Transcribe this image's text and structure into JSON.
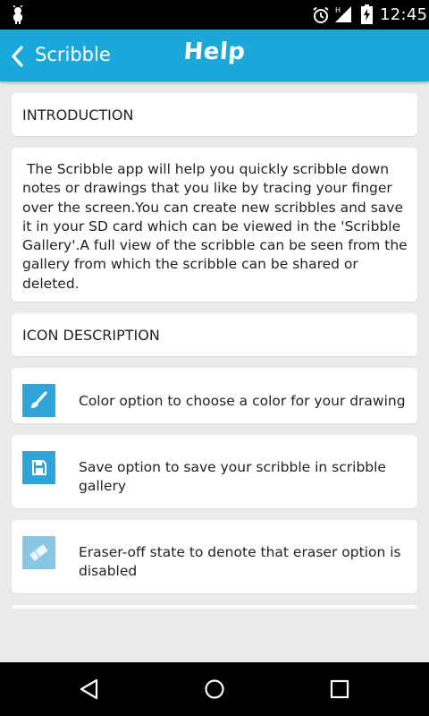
{
  "status_bar": {
    "time": "12:45",
    "icons": [
      "debug-icon",
      "alarm-icon",
      "signal-icon",
      "battery-icon"
    ],
    "signal_label": "H"
  },
  "app_bar": {
    "back_label": "Scribble",
    "title": "Help",
    "color": "#1aa7d9"
  },
  "sections": {
    "introduction": {
      "heading": "INTRODUCTION",
      "body": " The Scribble app will help you quickly scribble down notes or drawings that you like by tracing your finger over the screen.You can create new scribbles and save it in your SD card which can be viewed in the 'Scribble Gallery'.A full view of the scribble can be seen from the gallery from which the scribble can be shared or deleted."
    },
    "icon_description": {
      "heading": "ICON DESCRIPTION",
      "items": [
        {
          "icon": "brush-icon",
          "text": "Color option to choose a color for your drawing"
        },
        {
          "icon": "save-icon",
          "text": "Save option to save your scribble in scribble gallery"
        },
        {
          "icon": "eraser-icon",
          "text": "Eraser-off state to denote that eraser option is disabled"
        }
      ]
    }
  },
  "nav_bar": {
    "icons": [
      "back-nav-icon",
      "home-nav-icon",
      "recents-nav-icon"
    ]
  },
  "colors": {
    "accent": "#1aa7d9",
    "icon_tile": "#2ea4d8",
    "background": "#eaeaea"
  }
}
